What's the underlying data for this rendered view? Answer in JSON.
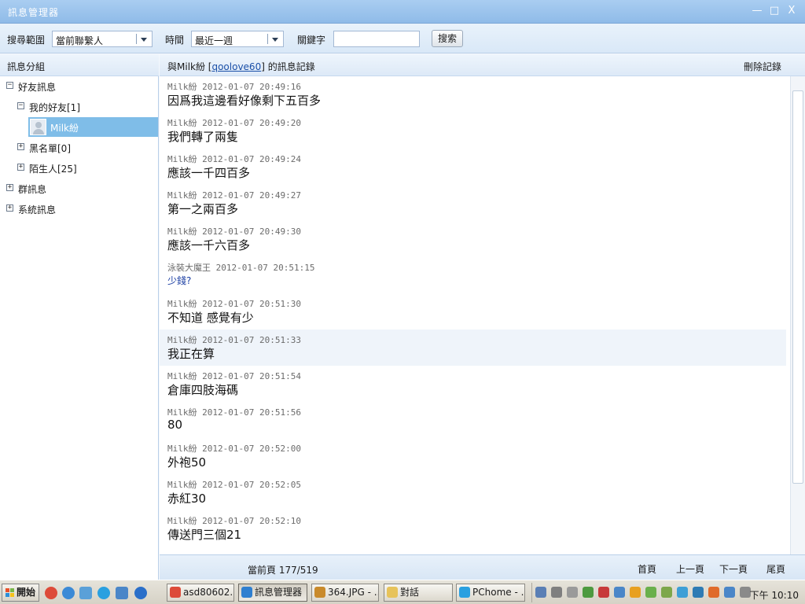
{
  "window": {
    "title": "訊息管理器",
    "controls": [
      "—",
      "□",
      "X"
    ]
  },
  "search": {
    "scope_label": "搜尋範圍",
    "scope_value": "當前聯繫人",
    "time_label": "時間",
    "time_value": "最近一週",
    "keyword_label": "關鍵字",
    "keyword_value": "",
    "search_button": "搜索"
  },
  "sidebar": {
    "heading": "訊息分組",
    "items": [
      {
        "expander": "⊟",
        "label": "好友訊息"
      },
      {
        "expander": "⊟",
        "label": "我的好友[1]"
      },
      {
        "expander": "",
        "label": "Milk紛"
      },
      {
        "expander": "⊞",
        "label": "黑名單[0]"
      },
      {
        "expander": "⊞",
        "label": "陌生人[25]"
      },
      {
        "expander": "⊞",
        "label": "群訊息"
      },
      {
        "expander": "⊞",
        "label": "系統訊息"
      }
    ]
  },
  "conversation": {
    "prefix": "與Milk紛 [",
    "contact_id": "qoolove60",
    "suffix": "] 的訊息記錄",
    "delete_label": "刪除記錄"
  },
  "messages": [
    {
      "sender": "Milk紛",
      "time": "2012-01-07 20:49:16",
      "text": "因爲我這邊看好像剩下五百多"
    },
    {
      "sender": "Milk紛",
      "time": "2012-01-07 20:49:20",
      "text": "我們轉了兩隻"
    },
    {
      "sender": "Milk紛",
      "time": "2012-01-07 20:49:24",
      "text": "應該一千四百多"
    },
    {
      "sender": "Milk紛",
      "time": "2012-01-07 20:49:27",
      "text": "第一之兩百多"
    },
    {
      "sender": "Milk紛",
      "time": "2012-01-07 20:49:30",
      "text": "應該一千六百多"
    },
    {
      "sender": "泳裝大魔王",
      "time": "2012-01-07 20:51:15",
      "text": "少錢?"
    },
    {
      "sender": "Milk紛",
      "time": "2012-01-07 20:51:30",
      "text": "不知道 感覺有少"
    },
    {
      "sender": "Milk紛",
      "time": "2012-01-07 20:51:33",
      "text": "我正在算"
    },
    {
      "sender": "Milk紛",
      "time": "2012-01-07 20:51:54",
      "text": "倉庫四肢海碼"
    },
    {
      "sender": "Milk紛",
      "time": "2012-01-07 20:51:56",
      "text": "80"
    },
    {
      "sender": "Milk紛",
      "time": "2012-01-07 20:52:00",
      "text": "外袍50"
    },
    {
      "sender": "Milk紛",
      "time": "2012-01-07 20:52:05",
      "text": "赤紅30"
    },
    {
      "sender": "Milk紛",
      "time": "2012-01-07 20:52:10",
      "text": "傳送門三個21"
    }
  ],
  "pager": {
    "current": "當前頁 177/519",
    "first": "首頁",
    "prev": "上一頁",
    "next": "下一頁",
    "last": "尾頁"
  },
  "taskbar": {
    "start": "開始",
    "tasks": [
      {
        "label": "asd80602...",
        "icon_color": "#dd4b39"
      },
      {
        "label": "訊息管理器",
        "icon_color": "#2f7fd0"
      },
      {
        "label": "364.JPG - ...",
        "icon_color": "#c98a2b"
      },
      {
        "label": "對話",
        "icon_color": "#e7c35a"
      },
      {
        "label": "PChome - ...",
        "icon_color": "#2aa0e0"
      }
    ],
    "clock": "下午 10:10"
  },
  "colors": {
    "accent": "#7fbde8",
    "title_bar": "#9cc4ec",
    "link": "#1b50a8",
    "self_message": "#1b3ea3"
  }
}
